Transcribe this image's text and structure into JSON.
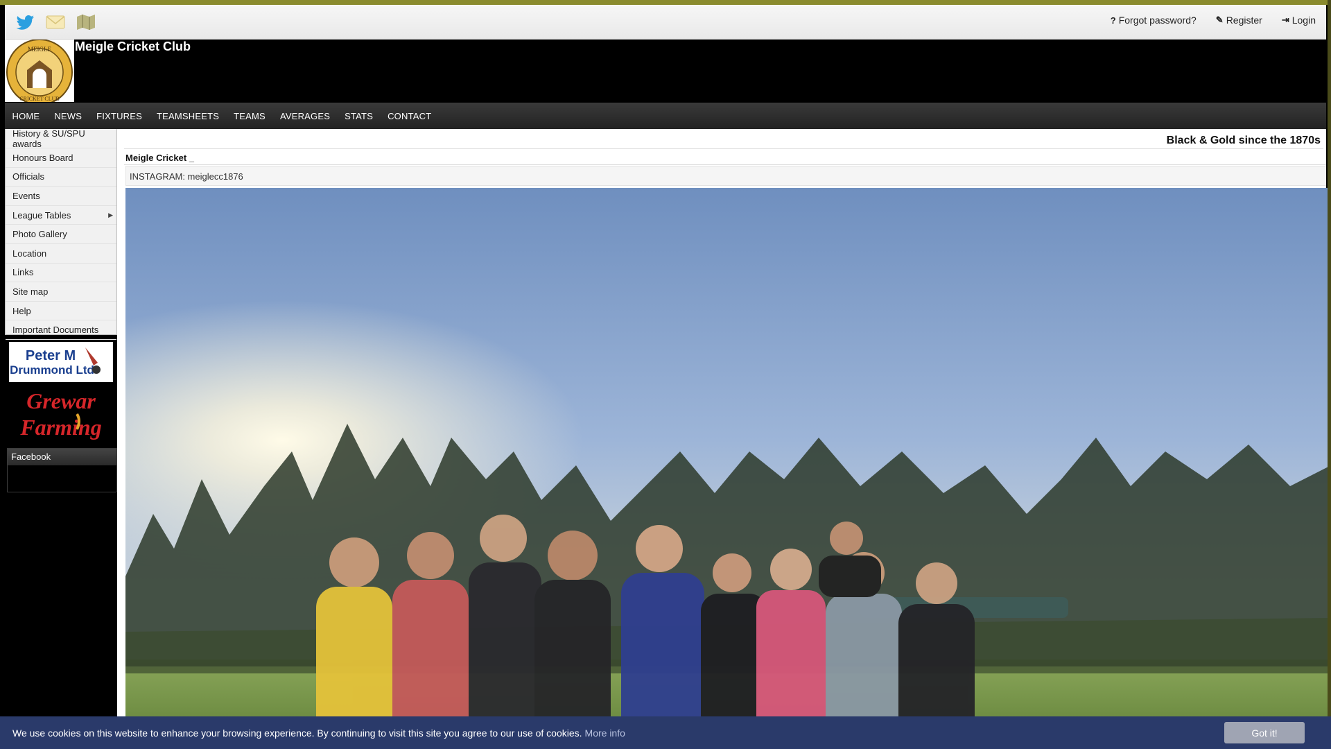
{
  "topbar": {
    "icons": [
      "twitter-icon",
      "mail-icon",
      "map-icon"
    ],
    "forgot_password": "Forgot password?",
    "register": "Register",
    "login": "Login"
  },
  "header": {
    "site_title": "Meigle Cricket Club",
    "logo_text_top": "MEIGLE",
    "logo_text_bottom": "CRICKET CLUB"
  },
  "nav": {
    "items": [
      "HOME",
      "NEWS",
      "FIXTURES",
      "TEAMSHEETS",
      "TEAMS",
      "AVERAGES",
      "STATS",
      "CONTACT"
    ]
  },
  "sidebar": {
    "items": [
      "History & SU/SPU awards",
      "Honours Board",
      "Officials",
      "Events",
      "League Tables",
      "Photo Gallery",
      "Location",
      "Links",
      "Site map",
      "Help",
      "Important Documents"
    ],
    "sponsor1": {
      "line1": "Peter M",
      "line2": "Drummond Ltd"
    },
    "sponsor2": {
      "line1": "Grewar",
      "line2": "Farming"
    },
    "facebook_label": "Facebook"
  },
  "main": {
    "tagline": "Black & Gold since the 1870s",
    "post_title": "Meigle Cricket _",
    "instagram": "INSTAGRAM: meiglecc1876"
  },
  "cookie": {
    "message": "We use cookies on this website to enhance your browsing experience. By continuing to visit this site you agree to our use of cookies.",
    "more_info": "More info",
    "button": "Got it!"
  },
  "colors": {
    "cookie_bg": "#2a3a6a",
    "gold": "#c9a23a",
    "accent_band": "#8a8b2e"
  }
}
